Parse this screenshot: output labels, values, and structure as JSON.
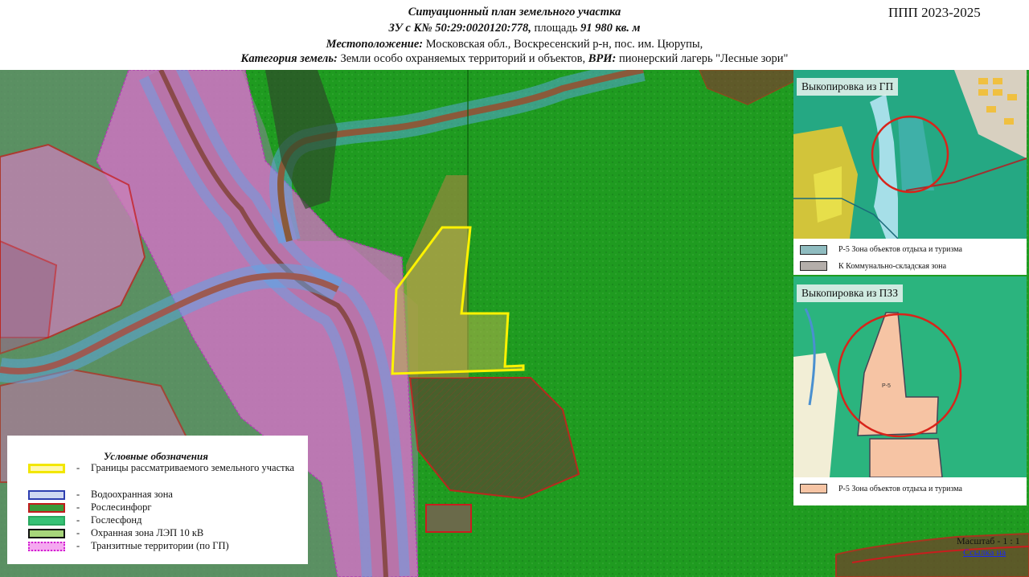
{
  "header": {
    "title": "Ситуационный план земельного участка",
    "parcel_prefix": "ЗУ с К№ 50:29:0020120:778,",
    "parcel_area_label": "площадь",
    "parcel_area_value": "91 980 кв. м",
    "location_label": "Местоположение:",
    "location_value": "Московская обл., Воскресенский р-н, пос. им. Цюрупы,",
    "category_label": "Категория земель:",
    "category_value": "Земли особо охраняемых территорий и объектов,",
    "vri_label": "ВРИ:",
    "vri_value": "пионерский лагерь \"Лесные зори\"",
    "code": "ППП 2023-2025"
  },
  "legend": {
    "title": "Условные обозначения",
    "items": [
      {
        "label": "Границы рассматриваемого земельного участка",
        "fill": "#fff8b0",
        "border": "#f2e600"
      },
      {
        "label": "Водоохранная зона",
        "fill": "#cfd8f2",
        "border": "#2e3fb0"
      },
      {
        "label": "Рослесинфорг",
        "fill": "#3a9a3a",
        "border": "#c21c1c"
      },
      {
        "label": "Гослесфонд",
        "fill": "#36c275",
        "border": "#36c275"
      },
      {
        "label": "Охранная зона ЛЭП 10 кВ",
        "fill": "#a7d57a",
        "border": "#111111"
      },
      {
        "label": "Транзитные территории (по ГП)",
        "fill": "#f5a8f0",
        "border": "#d21fd2"
      }
    ]
  },
  "insets": {
    "gp": {
      "title": "Выкопировка из ГП",
      "legend": [
        {
          "label": "Р-5 Зона объектов отдыха и туризма",
          "color": "#8fbcc0"
        },
        {
          "label": "К Коммунально-складская зона",
          "color": "#b4aeaa"
        }
      ]
    },
    "pzz": {
      "title": "Выкопировка из ПЗЗ",
      "zone_label": "Р-5",
      "legend": [
        {
          "label": "Р-5 Зона объектов отдыха и туризма",
          "color": "#f6c4a4"
        }
      ]
    }
  },
  "footer": {
    "scale": "Масштаб - 1 : 1",
    "link": "Ссылка на"
  },
  "colors": {
    "forest": "#1f9b20",
    "parcel": "#fff200",
    "transit": "#e46fd4",
    "water_zone": "#5aa7e8",
    "rosles_border": "#c81e1e"
  }
}
